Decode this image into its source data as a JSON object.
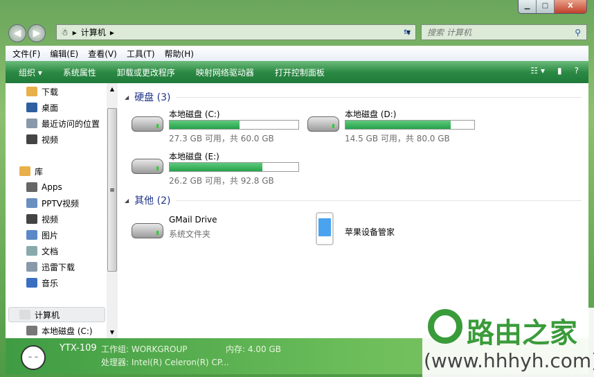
{
  "window": {
    "minimize": "▁",
    "maximize": "□",
    "close": "X"
  },
  "address": {
    "root_icon": "computer-bunny-icon",
    "path": [
      "计算机"
    ],
    "search_placeholder": "搜索 计算机"
  },
  "menu": [
    "文件(F)",
    "编辑(E)",
    "查看(V)",
    "工具(T)",
    "帮助(H)"
  ],
  "commands": [
    "组织 ▾",
    "系统属性",
    "卸载或更改程序",
    "映射网络驱动器",
    "打开控制面板"
  ],
  "sidebar": {
    "favorites": [
      {
        "label": "下载",
        "icon": "download-folder-icon",
        "color": "#e8b04a"
      },
      {
        "label": "桌面",
        "icon": "desktop-icon",
        "color": "#2f5fa0"
      },
      {
        "label": "最近访问的位置",
        "icon": "recent-places-icon",
        "color": "#8899aa"
      },
      {
        "label": "视频",
        "icon": "video-icon",
        "color": "#444"
      }
    ],
    "library": {
      "label": "库",
      "items": [
        {
          "label": "Apps",
          "icon": "app-icon",
          "color": "#666"
        },
        {
          "label": "PPTV视频",
          "icon": "document-icon",
          "color": "#6a8fc0"
        },
        {
          "label": "视频",
          "icon": "video-icon",
          "color": "#444"
        },
        {
          "label": "图片",
          "icon": "picture-icon",
          "color": "#5b89c7"
        },
        {
          "label": "文档",
          "icon": "document-icon",
          "color": "#8aa"
        },
        {
          "label": "迅雷下载",
          "icon": "document-icon",
          "color": "#89a"
        },
        {
          "label": "音乐",
          "icon": "music-icon",
          "color": "#3a6fc0"
        }
      ]
    },
    "computer": {
      "label": "计算机",
      "items": [
        {
          "label": "本地磁盘 (C:)",
          "icon": "windows-drive-icon",
          "color": "#777"
        }
      ]
    }
  },
  "groups": [
    {
      "title": "硬盘 (3)",
      "items": [
        {
          "name": "本地磁盘 (C:)",
          "info": "27.3 GB 可用，共 60.0 GB",
          "used_fraction": 0.545
        },
        {
          "name": "本地磁盘 (D:)",
          "info": "14.5 GB 可用，共 80.0 GB",
          "used_fraction": 0.819
        },
        {
          "name": "本地磁盘 (E:)",
          "info": "26.2 GB 可用，共 92.8 GB",
          "used_fraction": 0.718
        }
      ]
    },
    {
      "title": "其他 (2)",
      "items": [
        {
          "name": "GMail Drive",
          "info": "系统文件夹"
        },
        {
          "name": "苹果设备管家"
        }
      ]
    }
  ],
  "status": {
    "computer": "YTX-109",
    "workgroup": "工作组: WORKGROUP",
    "memory": "内存: 4.00 GB",
    "cpu": "处理器: Intel(R) Celeron(R) CP..."
  },
  "watermark": {
    "brand": "路由之家",
    "url": "(www.hhhyh.com)"
  }
}
